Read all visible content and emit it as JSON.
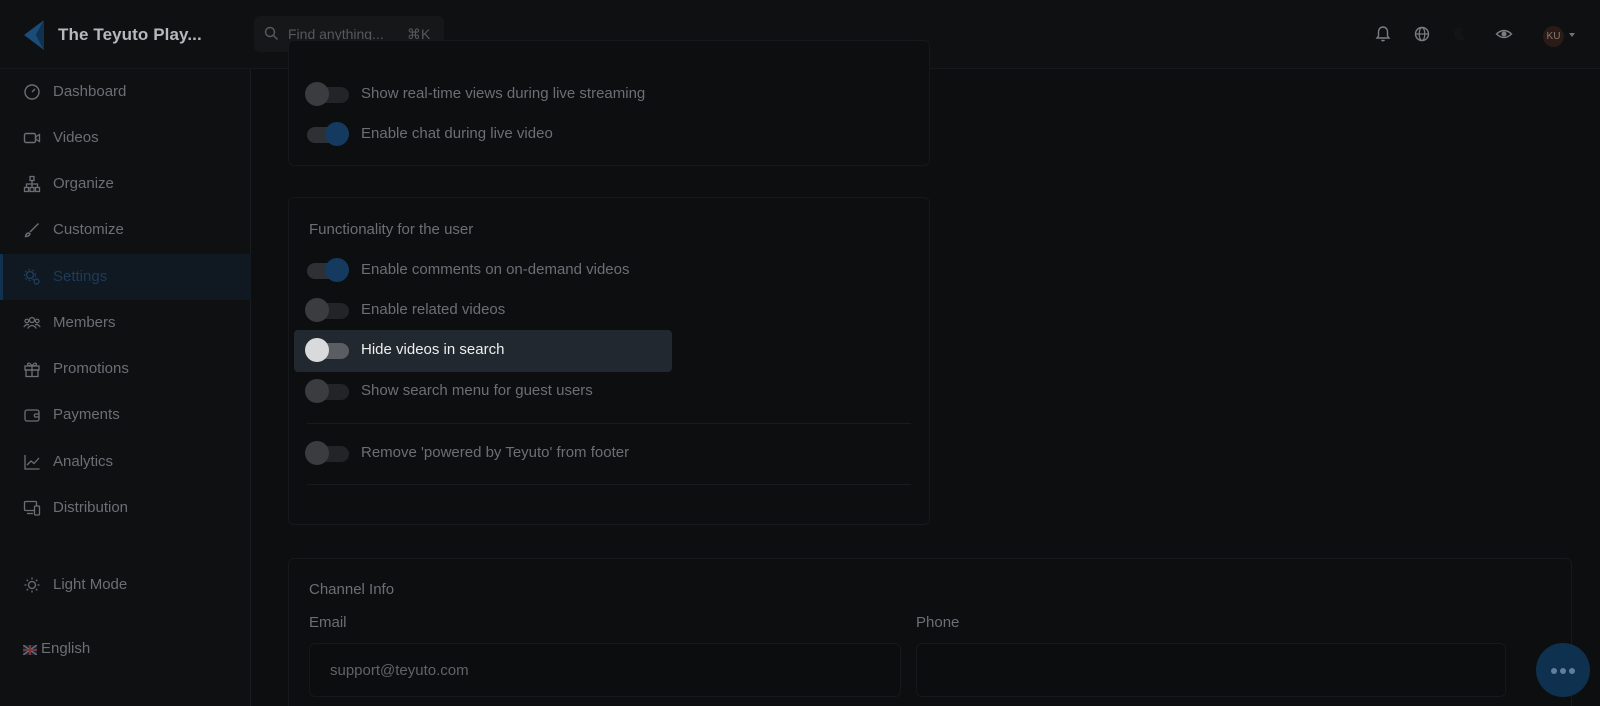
{
  "app": {
    "title": "The Teyuto Play...",
    "search_placeholder": "Find anything...",
    "search_shortcut": "⌘K",
    "avatar_initials": "KU"
  },
  "sidebar": {
    "items": [
      {
        "label": "Dashboard",
        "icon": "dashboard-icon"
      },
      {
        "label": "Videos",
        "icon": "video-camera-icon"
      },
      {
        "label": "Organize",
        "icon": "hierarchy-icon"
      },
      {
        "label": "Customize",
        "icon": "brush-icon"
      },
      {
        "label": "Settings",
        "icon": "gears-icon",
        "active": true
      },
      {
        "label": "Members",
        "icon": "users-icon"
      },
      {
        "label": "Promotions",
        "icon": "gift-icon"
      },
      {
        "label": "Payments",
        "icon": "wallet-icon"
      },
      {
        "label": "Analytics",
        "icon": "chart-line-icon"
      },
      {
        "label": "Distribution",
        "icon": "devices-icon"
      }
    ],
    "light_mode": "Light Mode",
    "language": "English"
  },
  "live_section": {
    "toggles": [
      {
        "label": "Show real-time views during live streaming",
        "on": false
      },
      {
        "label": "Enable chat during live video",
        "on": true
      }
    ]
  },
  "user_section": {
    "title": "Functionality for the user",
    "toggles": [
      {
        "label": "Enable comments on on-demand videos",
        "on": true
      },
      {
        "label": "Enable related videos",
        "on": false
      },
      {
        "label": "Hide videos in search",
        "on": false
      },
      {
        "label": "Show search menu for guest users",
        "on": false
      },
      {
        "label": "Remove 'powered by Teyuto' from footer",
        "on": false
      }
    ]
  },
  "channel_info": {
    "title": "Channel Info",
    "email_label": "Email",
    "email_value": "support@teyuto.com",
    "phone_label": "Phone",
    "phone_value": ""
  },
  "colors": {
    "accent": "#143a5f",
    "background": "#0d0e10"
  }
}
